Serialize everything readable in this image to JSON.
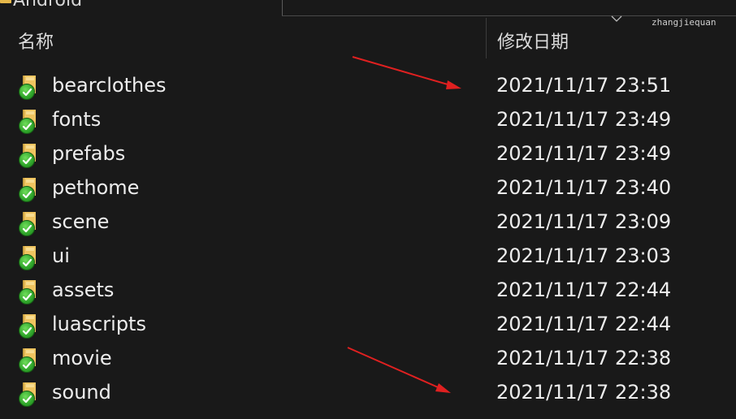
{
  "header": {
    "breadcrumb_current": "Android",
    "user": "zhangjiequan"
  },
  "columns": {
    "name": "名称",
    "date_modified": "修改日期"
  },
  "files": [
    {
      "name": "bearclothes",
      "date": "2021/11/17 23:51"
    },
    {
      "name": "fonts",
      "date": "2021/11/17 23:49"
    },
    {
      "name": "prefabs",
      "date": "2021/11/17 23:49"
    },
    {
      "name": "pethome",
      "date": "2021/11/17 23:40"
    },
    {
      "name": "scene",
      "date": "2021/11/17 23:09"
    },
    {
      "name": "ui",
      "date": "2021/11/17 23:03"
    },
    {
      "name": "assets",
      "date": "2021/11/17 22:44"
    },
    {
      "name": "luascripts",
      "date": "2021/11/17 22:44"
    },
    {
      "name": "movie",
      "date": "2021/11/17 22:38"
    },
    {
      "name": "sound",
      "date": "2021/11/17 22:38"
    }
  ],
  "icons": {
    "folder": "folder-icon",
    "sync_status": "sync-ok-check-icon",
    "sort_indicator": "chevron-down-icon"
  },
  "colors": {
    "background": "#191919",
    "text": "#ededed",
    "folder": "#efc460",
    "sync_check": "#2fa52a",
    "annotation_arrow": "#e02020"
  }
}
